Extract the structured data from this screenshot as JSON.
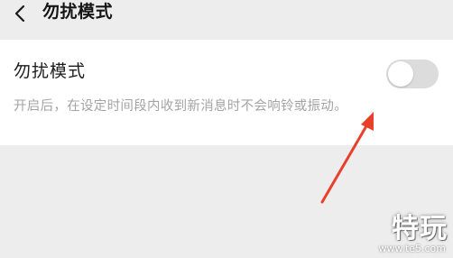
{
  "navbar": {
    "back_icon": "chevron-left-icon",
    "title": "勿扰模式"
  },
  "setting": {
    "label": "勿扰模式",
    "description": "开启后，在设定时间段内收到新消息时不会响铃或振动。",
    "toggle_on": false
  },
  "annotation": {
    "arrow_color": "#e8402b"
  },
  "watermark": {
    "brand": "特玩",
    "url": "www.te5.com"
  }
}
